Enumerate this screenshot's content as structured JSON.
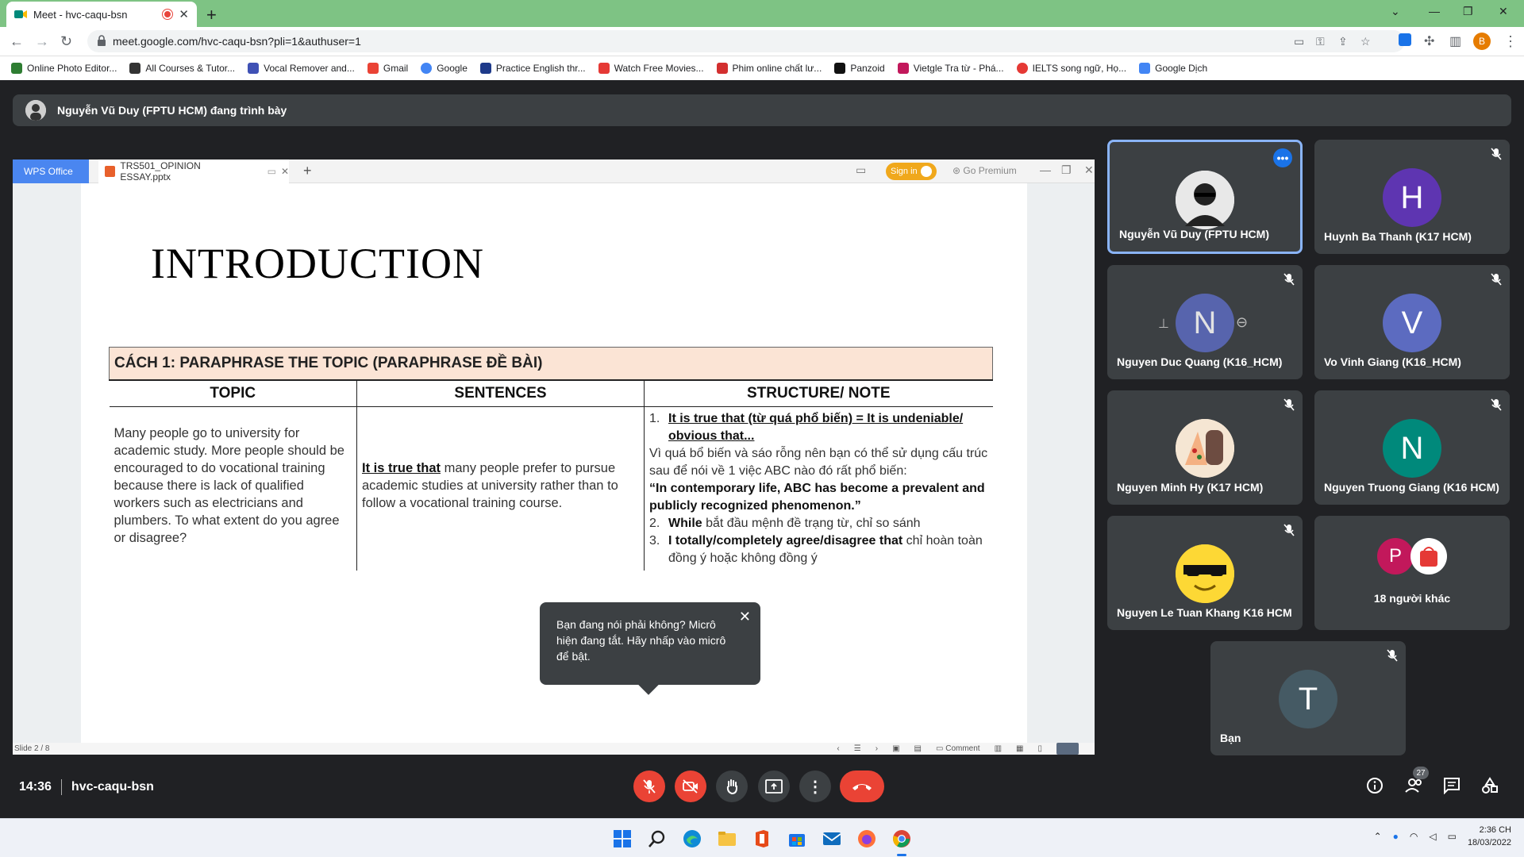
{
  "browser": {
    "tab_title": "Meet - hvc-caqu-bsn",
    "url": "meet.google.com/hvc-caqu-bsn?pli=1&authuser=1",
    "profile_initial": "B",
    "bookmarks": [
      {
        "label": "Online Photo Editor...",
        "icon": "photo-editor-icon",
        "color": "#2e7d32"
      },
      {
        "label": "All Courses & Tutor...",
        "icon": "courses-icon",
        "color": "#333333"
      },
      {
        "label": "Vocal Remover and...",
        "icon": "vocal-remover-icon",
        "color": "#3f51b5"
      },
      {
        "label": "Gmail",
        "icon": "gmail-icon",
        "color": "#ea4335"
      },
      {
        "label": "Google",
        "icon": "google-icon",
        "color": "#4285f4"
      },
      {
        "label": "Practice English thr...",
        "icon": "practice-english-icon",
        "color": "#1e3a8a"
      },
      {
        "label": "Watch Free Movies...",
        "icon": "youtube-icon",
        "color": "#e53935"
      },
      {
        "label": "Phim online chất lư...",
        "icon": "xp-icon",
        "color": "#d32f2f"
      },
      {
        "label": "Panzoid",
        "icon": "panzoid-icon",
        "color": "#111111"
      },
      {
        "label": "Vietgle Tra từ - Phá...",
        "icon": "vietgle-icon",
        "color": "#c2185b"
      },
      {
        "label": "IELTS song ngữ, Họ...",
        "icon": "ielts-icon",
        "color": "#e53935"
      },
      {
        "label": "Google Dịch",
        "icon": "google-translate-icon",
        "color": "#4285f4"
      }
    ]
  },
  "meet": {
    "presenter_text": "Nguyễn Vũ Duy (FPTU HCM) đang trình bày",
    "time": "14:36",
    "meeting_code": "hvc-caqu-bsn",
    "people_count": "27",
    "mic_popup": "Bạn đang nói phải không? Micrô hiện đang tắt. Hãy nhấp vào micrô để bật.",
    "participants": [
      {
        "name": "Nguyễn Vũ Duy (FPTU HCM)",
        "initial": "",
        "color": "#ffffff",
        "kind": "photo"
      },
      {
        "name": "Huynh Ba Thanh (K17 HCM)",
        "initial": "H",
        "color": "#5e35b1",
        "kind": "letter"
      },
      {
        "name": "Nguyen Duc Quang (K16_HCM)",
        "initial": "N",
        "color": "#5c6bc0",
        "kind": "letter"
      },
      {
        "name": "Vo Vinh Giang (K16_HCM)",
        "initial": "V",
        "color": "#5c6bc0",
        "kind": "letter"
      },
      {
        "name": "Nguyen Minh Hy (K17 HCM)",
        "initial": "",
        "color": "#f5e6d3",
        "kind": "cartoon"
      },
      {
        "name": "Nguyen Truong Giang (K16 HCM)",
        "initial": "N",
        "color": "#00897b",
        "kind": "letter"
      },
      {
        "name": "Nguyen Le Tuan Khang K16 HCM",
        "initial": "",
        "color": "#fdd835",
        "kind": "emoji"
      },
      {
        "name": "18 người khác",
        "initial": "P",
        "color": "#c2185b",
        "kind": "group"
      },
      {
        "name": "Bạn",
        "initial": "T",
        "color": "#455a64",
        "kind": "letter"
      }
    ]
  },
  "wps": {
    "app_label": "WPS Office",
    "doc_tab": "TRS501_OPINION ESSAY.pptx",
    "sign_in": "Sign in",
    "go_premium": "Go Premium",
    "slide_status": "Slide 2 / 8",
    "comment": "Comment"
  },
  "slide": {
    "title": "INTRODUCTION",
    "method_header": "CÁCH 1: PARAPHRASE THE TOPIC (PARAPHRASE ĐỀ BÀI)",
    "col_topic": "TOPIC",
    "col_sentences": "SENTENCES",
    "col_structure": "STRUCTURE/ NOTE",
    "topic_text": "Many people go to university for academic study. More people should be encouraged to do vocational training because there is lack of qualified workers such as electricians and plumbers. To what extent do you agree or disagree?",
    "sentence_bold": "It is true that",
    "sentence_rest": " many people prefer to pursue academic studies at university rather than to follow a vocational training course.",
    "note1_num": "1.",
    "note1_bold": "It is true that (từ quá phổ biến) = It is undeniable/ obvious that...",
    "note1_text": "Vì quá bổ biến và sáo rỗng nên bạn có thể sử dụng cấu trúc sau để nói về 1 việc ABC nào đó rất phổ biến:",
    "note1_quote": "“In contemporary life, ABC has become a prevalent and publicly recognized phenomenon.”",
    "note2_num": "2.",
    "note2_bold": "While",
    "note2_text": " bắt đầu mệnh đề trạng từ, chỉ so sánh",
    "note3_num": "3.",
    "note3_bold": "I totally/completely  agree/disagree that",
    "note3_text": " chỉ hoàn toàn đồng ý hoặc không đồng ý"
  },
  "system": {
    "time": "2:36 CH",
    "date": "18/03/2022"
  }
}
